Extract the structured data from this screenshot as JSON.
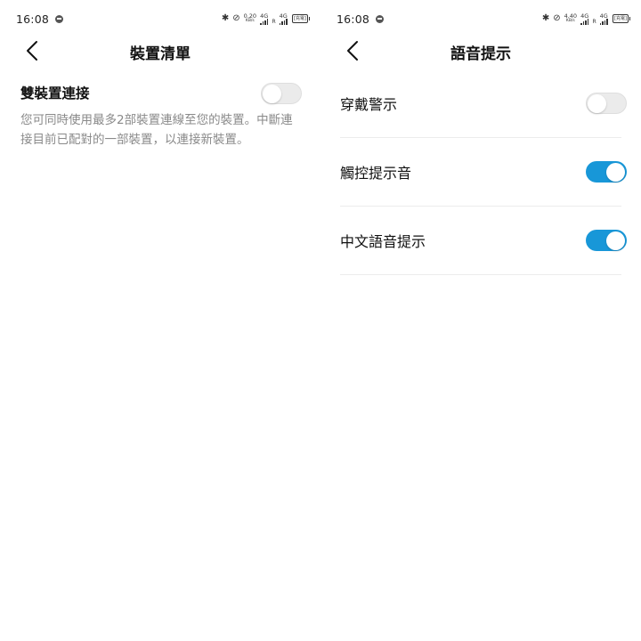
{
  "left_screen": {
    "status_bar": {
      "time": "16:08",
      "speed_value": "0.20",
      "speed_unit": "KB/s",
      "net_label_1": "4G",
      "net_label_2": "4G",
      "roaming": "R",
      "battery_label": "[充電]"
    },
    "header": {
      "title": "裝置清單"
    },
    "dual_connection": {
      "title": "雙裝置連接",
      "description": "您可同時使用最多2部裝置連線至您的裝置。中斷連接目前已配對的一部裝置，以連接新裝置。",
      "enabled": false
    }
  },
  "right_screen": {
    "status_bar": {
      "time": "16:08",
      "speed_value": "4.40",
      "speed_unit": "KB/s",
      "net_label_1": "4G",
      "net_label_2": "4G",
      "roaming": "R",
      "battery_label": "[充電]"
    },
    "header": {
      "title": "語音提示"
    },
    "settings": [
      {
        "label": "穿戴警示",
        "enabled": false
      },
      {
        "label": "觸控提示音",
        "enabled": true
      },
      {
        "label": "中文語音提示",
        "enabled": true
      }
    ]
  },
  "colors": {
    "toggle_on": "#1897d8",
    "toggle_off": "#ebebeb",
    "description_text": "#8a8a8a",
    "divider": "#ececec"
  },
  "icons": {
    "back": "chevron-left-icon",
    "bluetooth": "bluetooth-icon",
    "mute": "mute-icon",
    "message": "message-icon"
  }
}
